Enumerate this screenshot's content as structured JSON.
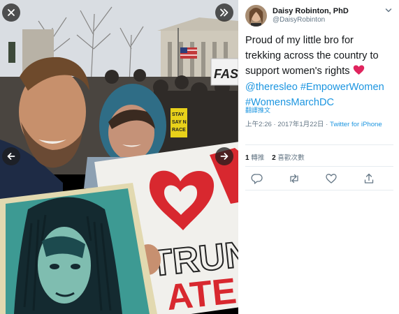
{
  "author": {
    "name": "Daisy Robinton, PhD",
    "handle": "@DaisyRobinton"
  },
  "tweet": {
    "text_lines": [
      "Proud of my little bro for",
      "trekking across the country to",
      "support women's rights"
    ],
    "mention": "@theresleo",
    "hashtag1": "#EmpowerWomen",
    "hashtag2": "#WomensMarchDC",
    "translate_label": "翻譯推文"
  },
  "meta": {
    "timestamp": "上午2:26 · 2017年1月22日",
    "source_label": "Twitter for iPhone"
  },
  "stats": {
    "retweets_count": "1",
    "retweets_label": "轉推",
    "likes_count": "2",
    "likes_label": "喜歡次數"
  },
  "photo_sign": {
    "top_sign": "FAS",
    "side_sign_lines": [
      "STAY",
      "SAY N",
      "RACE"
    ],
    "big_sign_lines": [
      "TRUN",
      "ATE"
    ]
  },
  "icons": {
    "close": "close-icon",
    "forward": "double-chevron-right-icon",
    "prev": "arrow-left-icon",
    "next": "arrow-right-icon",
    "caret": "chevron-down-icon",
    "reply": "reply-icon",
    "retweet": "retweet-icon",
    "like": "heart-icon",
    "share": "share-icon"
  },
  "colors": {
    "accent": "#1b95e0",
    "heart_emoji": "#e0245e"
  }
}
